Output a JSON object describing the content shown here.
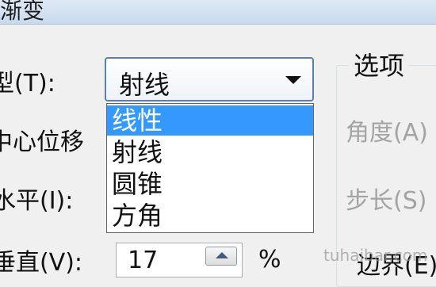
{
  "window": {
    "title": "渐变"
  },
  "labels": {
    "type": "型(T):",
    "center_offset": "中心位移",
    "horizontal": "水平(I):",
    "vertical": "垂直(V):",
    "percent": "%"
  },
  "gradient_type": {
    "selected": "射线",
    "options": [
      "线性",
      "射线",
      "圆锥",
      "方角"
    ],
    "highlighted_index": 0
  },
  "vertical_value": "17",
  "options_group": {
    "title": "选项",
    "angle_label": "角度(A)",
    "step_label": "步长(S)",
    "border_label": "边界(E)"
  },
  "watermark": "tuhaibar.com",
  "colors": {
    "highlight": "#3399ff",
    "combo_border": "#5b7fb0",
    "disabled_text": "#a4a4a4"
  }
}
